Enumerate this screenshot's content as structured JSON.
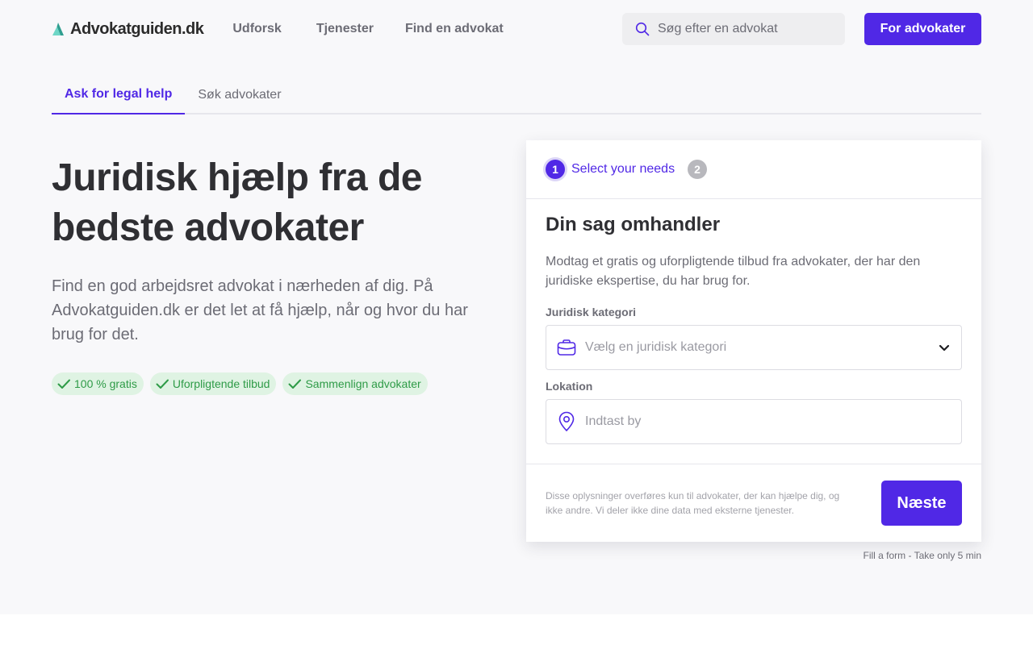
{
  "header": {
    "logo_text": "Advokatguiden.dk",
    "nav": [
      "Udforsk",
      "Tjenester",
      "Find en advokat"
    ],
    "search_placeholder": "Søg efter en advokat",
    "cta_label": "For advokater"
  },
  "tabs": [
    {
      "label": "Ask for legal help",
      "active": true
    },
    {
      "label": "Søk advokater",
      "active": false
    }
  ],
  "hero": {
    "title": "Juridisk hjælp fra de bedste advokater",
    "subtitle": "Find en god arbejdsret advokat i nærheden af dig. På Advokatguiden.dk er det let at få hjælp, når og hvor du har brug for det.",
    "badges": [
      "100 % gratis",
      "Uforpligtende tilbud",
      "Sammenlign advokater"
    ]
  },
  "form": {
    "steps": [
      {
        "number": "1",
        "label": "Select your needs"
      },
      {
        "number": "2"
      }
    ],
    "title": "Din sag omhandler",
    "description": "Modtag et gratis og uforpligtende tilbud fra advokater, der har den juridiske ekspertise, du har brug for.",
    "category_label": "Juridisk kategori",
    "category_placeholder": "Vælg en juridisk kategori",
    "location_label": "Lokation",
    "location_placeholder": "Indtast by",
    "disclaimer": "Disse oplysninger overføres kun til advokater, der kan hjælpe dig, og ikke andre. Vi deler ikke dine data med eksterne tjenester.",
    "next_label": "Næste",
    "note": "Fill a form - Take only 5 min"
  },
  "colors": {
    "accent": "#5028e6",
    "badge_bg": "#dff3e3",
    "badge_text": "#2e9b47",
    "logo_mark": "#3fc1b4"
  }
}
